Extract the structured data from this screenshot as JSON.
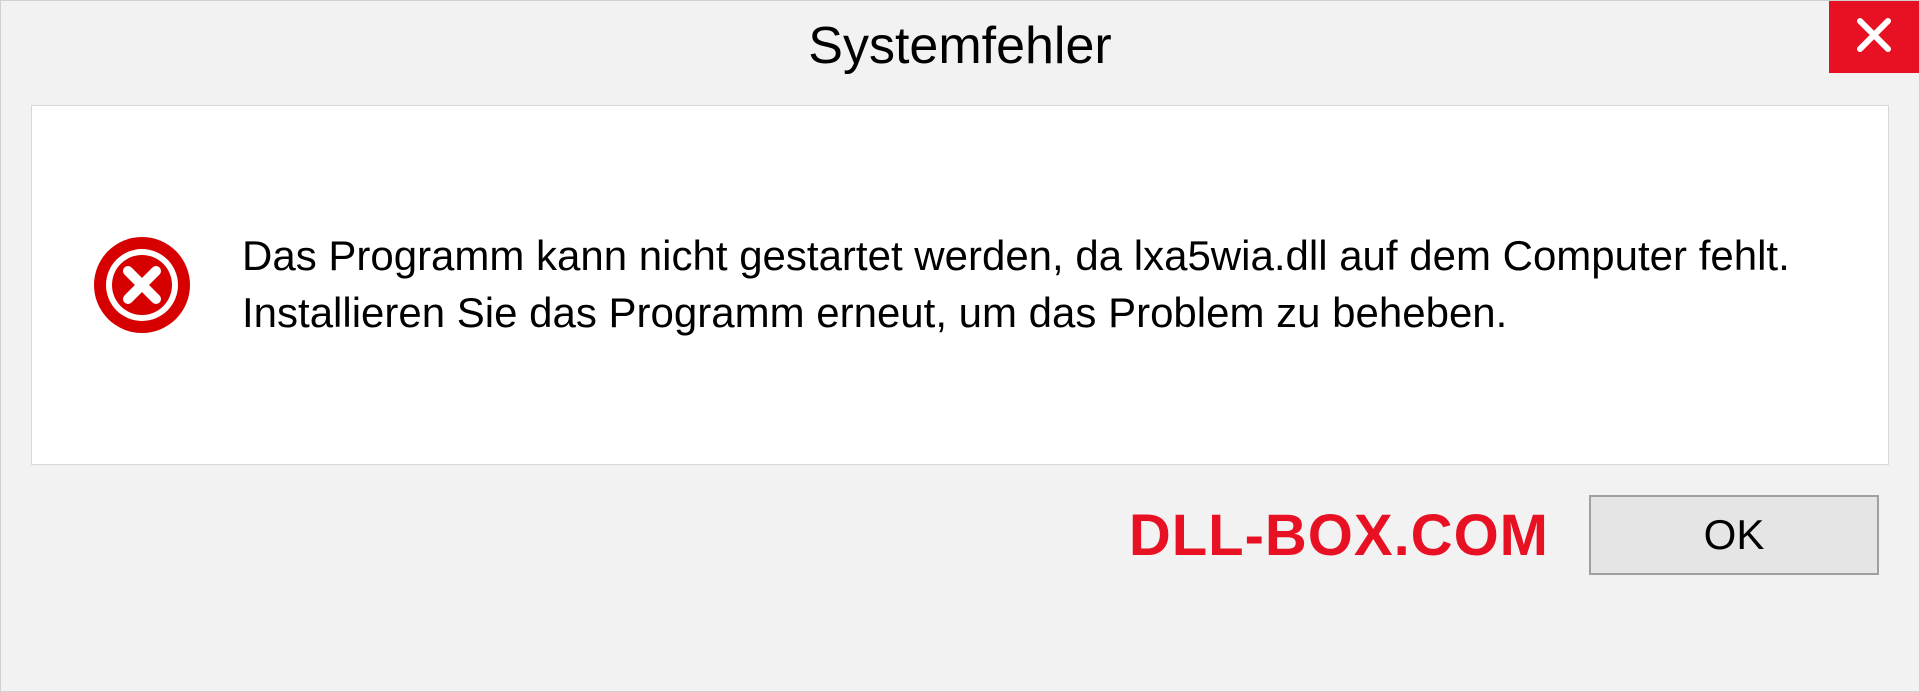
{
  "dialog": {
    "title": "Systemfehler",
    "message": "Das Programm kann nicht gestartet werden, da lxa5wia.dll auf dem Computer fehlt. Installieren Sie das Programm erneut, um das Problem zu beheben.",
    "ok_label": "OK"
  },
  "watermark": "DLL-BOX.COM",
  "colors": {
    "close_red": "#e81123",
    "error_red": "#d60000",
    "watermark_red": "#e81123"
  }
}
